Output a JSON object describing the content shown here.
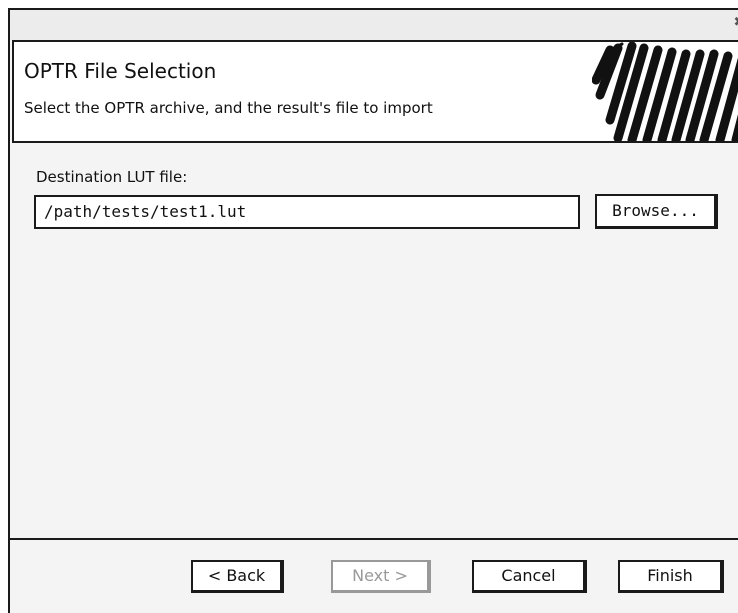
{
  "window": {
    "close_glyph": "✖"
  },
  "header": {
    "title": "OPTR File Selection",
    "subtitle": "Select the OPTR archive, and the result's file to import"
  },
  "form": {
    "destination_label": "Destination LUT file:",
    "destination_value": "/path/tests/test1.lut",
    "browse_label": "Browse..."
  },
  "footer": {
    "back_label": "< Back",
    "next_label": "Next >",
    "next_enabled": false,
    "cancel_label": "Cancel",
    "finish_label": "Finish"
  },
  "icons": {
    "close": "close-icon",
    "header_graphic": "wizard-scribble-icon"
  },
  "colors": {
    "window_bg": "#f4f4f4",
    "border": "#1a1a1a",
    "disabled_text": "#999999"
  }
}
